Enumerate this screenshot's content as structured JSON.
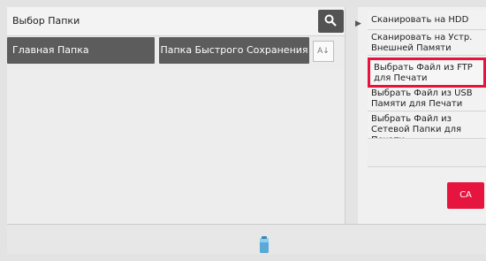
{
  "header": {
    "title": "Выбор Папки"
  },
  "folders": {
    "home_label": "Главная Папка",
    "quick_label": "Папка Быстрого Сохранения"
  },
  "sort": {
    "label": "A↓"
  },
  "menu": {
    "items": [
      {
        "label": "Сканировать на HDD"
      },
      {
        "label": "Сканировать на Устр. Внешней Памяти"
      },
      {
        "label": "Выбрать Файл из FTP для Печати"
      },
      {
        "label": "Выбрать Файл из USB Памяти для Печати"
      },
      {
        "label": "Выбрать Файл из Сетевой Папки для Печати"
      }
    ]
  },
  "ca_button": {
    "label": "CA"
  },
  "icons": {
    "search": "search-icon",
    "expand": "expand-arrow-icon",
    "job_status": "job-status-icon"
  },
  "colors": {
    "accent": "#e6153f",
    "selected_border": "#e8123c",
    "folder_tab_bg": "#5c5c5c",
    "search_btn_bg": "#535353"
  }
}
